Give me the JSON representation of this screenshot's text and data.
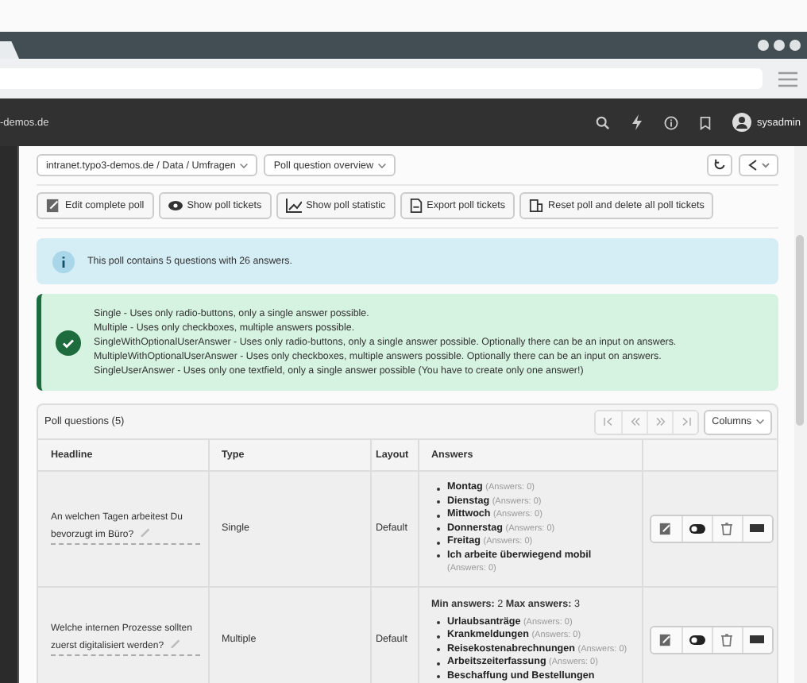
{
  "topbar": {
    "site": "-demos.de",
    "user": "sysadmin"
  },
  "docheader": {
    "breadcrumb": "intranet.typo3-demos.de / Data / Umfragen",
    "view": "Poll question overview"
  },
  "actions": [
    {
      "kind": "edit",
      "label": "Edit complete poll"
    },
    {
      "kind": "eye",
      "label": "Show poll tickets"
    },
    {
      "kind": "chart",
      "label": "Show poll statistic"
    },
    {
      "kind": "export",
      "label": "Export poll tickets"
    },
    {
      "kind": "reset",
      "label": "Reset poll and delete all poll tickets"
    }
  ],
  "info": "This poll contains 5 questions with 26 answers.",
  "notice": [
    "Single - Uses only radio-buttons, only a single answer possible.",
    "Multiple - Uses only checkboxes, multiple answers possible.",
    "SingleWithOptionalUserAnswer - Uses only radio-buttons, only a single answer possible. Optionally there can be an input on answers.",
    "MultipleWithOptionalUserAnswer - Uses only checkboxes, multiple answers possible. Optionally there can be an input on answers.",
    "SingleUserAnswer - Uses only one textfield, only a single answer possible (You have to create only one answer!)"
  ],
  "table": {
    "title": "Poll questions (5)",
    "columns_button": "Columns",
    "columns": [
      "Headline",
      "Type",
      "Layout",
      "Answers"
    ],
    "rows": [
      {
        "headline": "An welchen Tagen arbeitest Du bevorzugt im Büro?",
        "type": "Single",
        "layout": "Default",
        "answers": [
          {
            "label": "Montag",
            "count": "(Answers: 0)"
          },
          {
            "label": "Dienstag",
            "count": "(Answers: 0)"
          },
          {
            "label": "Mittwoch",
            "count": "(Answers: 0)"
          },
          {
            "label": "Donnerstag",
            "count": "(Answers: 0)"
          },
          {
            "label": "Freitag",
            "count": "(Answers: 0)"
          },
          {
            "label": "Ich arbeite überwiegend mobil",
            "count": "(Answers: 0)"
          }
        ]
      },
      {
        "headline": "Welche internen Prozesse sollten zuerst digitalisiert werden?",
        "type": "Multiple",
        "layout": "Default",
        "limits": "**Min answers:** 2 **Max answers:** 3",
        "answers": [
          {
            "label": "Urlaubsanträge",
            "count": "(Answers: 0)"
          },
          {
            "label": "Krankmeldungen",
            "count": "(Answers: 0)"
          },
          {
            "label": "Reisekostenabrechnungen",
            "count": "(Answers: 0)"
          },
          {
            "label": "Arbeitszeiterfassung",
            "count": "(Answers: 0)"
          },
          {
            "label": "Beschaffung und Bestellungen"
          }
        ]
      }
    ]
  }
}
